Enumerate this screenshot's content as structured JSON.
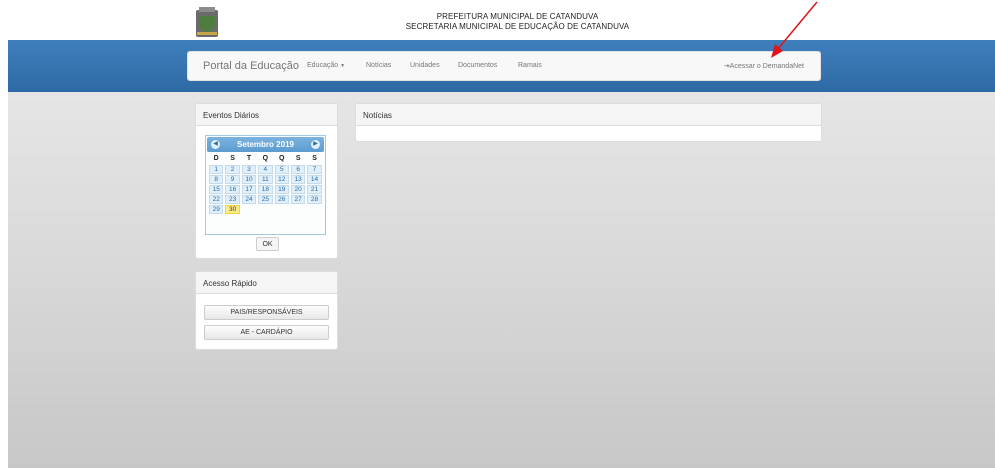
{
  "header": {
    "line1": "PREFEITURA MUNICIPAL DE CATANDUVA",
    "line2": "SECRETARIA MUNICIPAL DE EDUCAÇÃO DE CATANDUVA"
  },
  "navbar": {
    "brand": "Portal da Educação",
    "items": [
      {
        "label": "Educação",
        "has_dropdown": true
      },
      {
        "label": "Notícias"
      },
      {
        "label": "Unidades"
      },
      {
        "label": "Documentos"
      },
      {
        "label": "Ramais"
      }
    ],
    "login_label": "Acessar o DemandaNet"
  },
  "eventos": {
    "title": "Eventos Diários",
    "calendar": {
      "month_label": "Setembro",
      "year_label": "2019",
      "weekdays": [
        "D",
        "S",
        "T",
        "Q",
        "Q",
        "S",
        "S"
      ],
      "weeks": [
        [
          "1",
          "2",
          "3",
          "4",
          "5",
          "6",
          "7"
        ],
        [
          "8",
          "9",
          "10",
          "11",
          "12",
          "13",
          "14"
        ],
        [
          "15",
          "16",
          "17",
          "18",
          "19",
          "20",
          "21"
        ],
        [
          "22",
          "23",
          "24",
          "25",
          "26",
          "27",
          "28"
        ],
        [
          "29",
          "30",
          "",
          "",
          "",
          "",
          ""
        ]
      ],
      "selected_day": "30"
    },
    "ok_label": "OK"
  },
  "acesso": {
    "title": "Acesso Rápido",
    "buttons": [
      "PAIS/RESPONSÁVEIS",
      "AE - CARDÁPIO"
    ]
  },
  "noticias": {
    "title": "Notícias"
  },
  "colors": {
    "navbar_band": "#3f7fbd",
    "annotation": "#e0141b",
    "calendar_header": "#5b9bd0"
  }
}
